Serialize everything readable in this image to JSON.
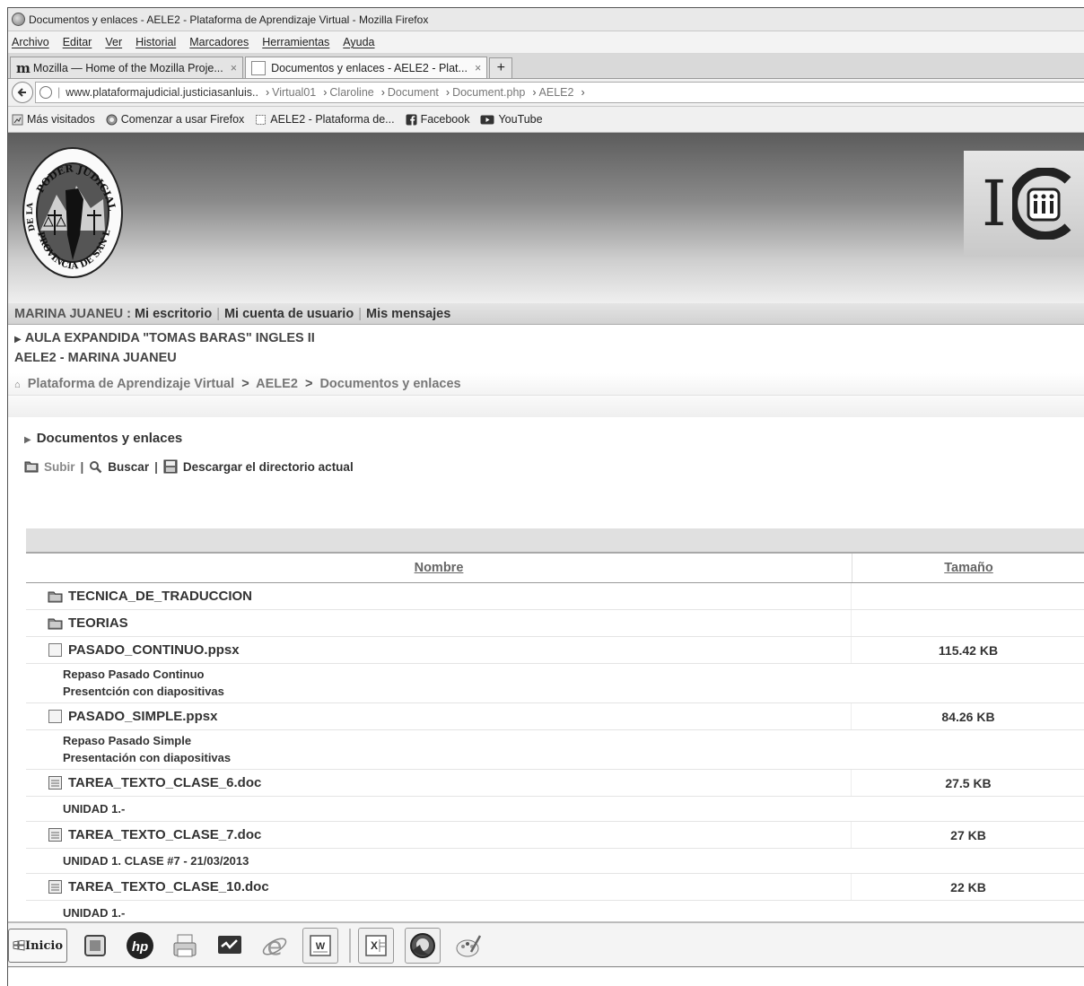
{
  "window": {
    "title": "Documentos y enlaces - AELE2 - Plataforma de Aprendizaje Virtual - Mozilla Firefox"
  },
  "menu": [
    "Archivo",
    "Editar",
    "Ver",
    "Historial",
    "Marcadores",
    "Herramientas",
    "Ayuda"
  ],
  "tabs": [
    {
      "label": "Mozilla — Home of the Mozilla Proje...",
      "close": "×",
      "icon": "mozilla-m-icon"
    },
    {
      "label": "Documentos y enlaces - AELE2 - Plat...",
      "close": "×",
      "icon": "page-icon"
    }
  ],
  "new_tab_label": "+",
  "url": {
    "host": "www.plataformajudicial.justiciasanluis..",
    "crumbs": [
      "Virtual01",
      "Claroline",
      "Document",
      "Document.php",
      "AELE2"
    ]
  },
  "bookmarks": [
    "Más visitados",
    "Comenzar a usar Firefox",
    "AELE2 - Plataforma de...",
    "Facebook",
    "YouTube"
  ],
  "banner": {
    "seal_top": "PODER JUDICIAL",
    "seal_left": "DE LA",
    "seal_bottom": "PROVINCIA DE SAN LUIS",
    "brand_letter": "I"
  },
  "userbar": {
    "user": "MARINA JUANEU :",
    "links": [
      "Mi escritorio",
      "Mi cuenta de usuario",
      "Mis mensajes"
    ]
  },
  "course": {
    "title": "AULA EXPANDIDA \"TOMAS BARAS\" INGLES II",
    "code": "AELE2 - MARINA JUANEU"
  },
  "breadcrumb": [
    "Plataforma de Aprendizaje Virtual",
    "AELE2",
    "Documentos y enlaces"
  ],
  "breadcrumb_sep": ">",
  "section_title": "Documentos y enlaces",
  "toolbar": {
    "up": "Subir",
    "search": "Buscar",
    "download": "Descargar el directorio actual",
    "sep": "|"
  },
  "table": {
    "headers": {
      "name": "Nombre",
      "size": "Tamaño"
    },
    "rows": [
      {
        "name": "TECNICA_DE_TRADUCCION",
        "icon": "folder-icon",
        "size": "",
        "desc": []
      },
      {
        "name": "TEORIAS",
        "icon": "folder-icon",
        "size": "",
        "desc": []
      },
      {
        "name": "PASADO_CONTINUO.ppsx",
        "icon": "file-icon",
        "size": "115.42 KB",
        "desc": [
          "Repaso Pasado Continuo",
          "Presentción con diapositivas"
        ]
      },
      {
        "name": "PASADO_SIMPLE.ppsx",
        "icon": "file-icon",
        "size": "84.26 KB",
        "desc": [
          "Repaso Pasado Simple",
          "Presentación con diapositivas"
        ]
      },
      {
        "name": "TAREA_TEXTO_CLASE_6.doc",
        "icon": "doc-icon",
        "size": "27.5 KB",
        "desc": [
          "UNIDAD 1.-"
        ]
      },
      {
        "name": "TAREA_TEXTO_CLASE_7.doc",
        "icon": "doc-icon",
        "size": "27 KB",
        "desc": [
          "UNIDAD 1. CLASE #7 - 21/03/2013"
        ]
      },
      {
        "name": "TAREA_TEXTO_CLASE_10.doc",
        "icon": "doc-icon",
        "size": "22 KB",
        "desc": [
          "UNIDAD 1.-"
        ]
      }
    ]
  },
  "taskbar": {
    "start_label": "Inicio",
    "items": [
      "media-player-icon",
      "hp-icon",
      "printer-icon",
      "monitor-icon",
      "internet-explorer-icon",
      "word-icon",
      "excel-icon",
      "firefox-icon",
      "paint-icon"
    ]
  }
}
